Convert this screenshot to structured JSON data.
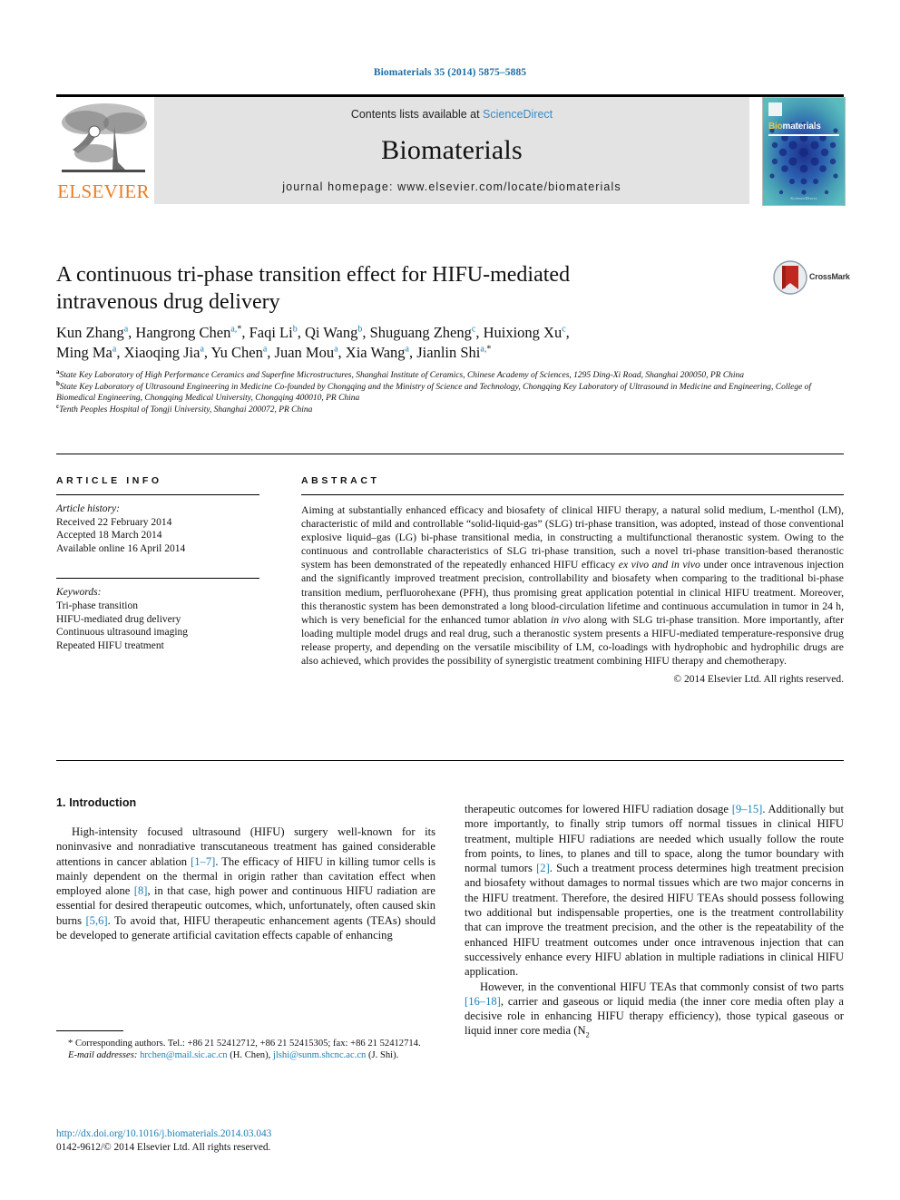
{
  "running_head": "Biomaterials 35 (2014) 5875–5885",
  "header": {
    "contents_prefix": "Contents lists available at ",
    "sciencedirect": "ScienceDirect",
    "journal_name": "Biomaterials",
    "homepage": "journal homepage: www.elsevier.com/locate/biomaterials",
    "publisher": "ELSEVIER",
    "cover_bio": "Bio",
    "cover_materials": "materials",
    "cover_footer": "Available online at\nScienceDirect",
    "accent_blue": "#3a8ac4",
    "elsevier_orange": "#ec7c22"
  },
  "article": {
    "title": "A continuous tri-phase transition effect for HIFU-mediated intravenous drug delivery",
    "crossmark_label": "CrossMark",
    "authors_line1": "Kun Zhang a, Hangrong Chen a,*, Faqi Li b, Qi Wang b, Shuguang Zheng c, Huixiong Xu c,",
    "authors_line2": "Ming Ma a, Xiaoqing Jia a, Yu Chen a, Juan Mou a, Xia Wang a, Jianlin Shi a,*",
    "affiliations": [
      {
        "marker": "a",
        "text": "State Key Laboratory of High Performance Ceramics and Superfine Microstructures, Shanghai Institute of Ceramics, Chinese Academy of Sciences, 1295 Ding-Xi Road, Shanghai 200050, PR China"
      },
      {
        "marker": "b",
        "text": "State Key Laboratory of Ultrasound Engineering in Medicine Co-founded by Chongqing and the Ministry of Science and Technology, Chongqing Key Laboratory of Ultrasound in Medicine and Engineering, College of Biomedical Engineering, Chongqing Medical University, Chongqing 400010, PR China"
      },
      {
        "marker": "c",
        "text": "Tenth Peoples Hospital of Tongji University, Shanghai 200072, PR China"
      }
    ]
  },
  "article_info": {
    "heading": "ARTICLE INFO",
    "history_label": "Article history:",
    "history": [
      "Received 22 February 2014",
      "Accepted 18 March 2014",
      "Available online 16 April 2014"
    ],
    "keywords_label": "Keywords:",
    "keywords": [
      "Tri-phase transition",
      "HIFU-mediated drug delivery",
      "Continuous ultrasound imaging",
      "Repeated HIFU treatment"
    ]
  },
  "abstract": {
    "heading": "ABSTRACT",
    "text_part1": "Aiming at substantially enhanced efficacy and biosafety of clinical HIFU therapy, a natural solid medium, L-menthol (LM), characteristic of mild and controllable “solid-liquid-gas” (SLG) tri-phase transition, was adopted, instead of those conventional explosive liquid–gas (LG) bi-phase transitional media, in constructing a multifunctional theranostic system. Owing to the continuous and controllable characteristics of SLG tri-phase transition, such a novel tri-phase transition-based theranostic system has been demonstrated of the repeatedly enhanced HIFU efficacy ",
    "em1": "ex vivo and in vivo",
    "text_part2": " under once intravenous injection and the significantly improved treatment precision, controllability and biosafety when comparing to the traditional bi-phase transition medium, perfluorohexane (PFH), thus promising great application potential in clinical HIFU treatment. Moreover, this theranostic system has been demonstrated a long blood-circulation lifetime and continuous accumulation in tumor in 24 h, which is very beneficial for the enhanced tumor ablation ",
    "em2": "in vivo",
    "text_part3": " along with SLG tri-phase transition. More importantly, after loading multiple model drugs and real drug, such a theranostic system presents a HIFU-mediated temperature-responsive drug release property, and depending on the versatile miscibility of LM, co-loadings with hydrophobic and hydrophilic drugs are also achieved, which provides the possibility of synergistic treatment combining HIFU therapy and chemotherapy.",
    "copyright": "© 2014 Elsevier Ltd. All rights reserved."
  },
  "body": {
    "section1_title": "1. Introduction",
    "left_p1_a": "High-intensity focused ultrasound (HIFU) surgery well-known for its noninvasive and nonradiative transcutaneous treatment has gained considerable attentions in cancer ablation ",
    "left_p1_ref1": "[1–7]",
    "left_p1_b": ". The efficacy of HIFU in killing tumor cells is mainly dependent on the thermal in origin rather than cavitation effect when employed alone ",
    "left_p1_ref2": "[8]",
    "left_p1_c": ", in that case, high power and continuous HIFU radiation are essential for desired therapeutic outcomes, which, unfortunately, often caused skin burns ",
    "left_p1_ref3": "[5,6]",
    "left_p1_d": ". To avoid that, HIFU therapeutic enhancement agents (TEAs) should be developed to generate artificial cavitation effects capable of enhancing",
    "right_p1_a": "therapeutic outcomes for lowered HIFU radiation dosage ",
    "right_p1_ref1": "[9–15]",
    "right_p1_b": ". Additionally but more importantly, to finally strip tumors off normal tissues in clinical HIFU treatment, multiple HIFU radiations are needed which usually follow the route from points, to lines, to planes and till to space, along the tumor boundary with normal tumors ",
    "right_p1_ref2": "[2]",
    "right_p1_c": ". Such a treatment process determines high treatment precision and biosafety without damages to normal tissues which are two major concerns in the HIFU treatment. Therefore, the desired HIFU TEAs should possess following two additional but indispensable properties, one is the treatment controllability that can improve the treatment precision, and the other is the repeatability of the enhanced HIFU treatment outcomes under once intravenous injection that can successively enhance every HIFU ablation in multiple radiations in clinical HIFU application.",
    "right_p2_a": "However, in the conventional HIFU TEAs that commonly consist of two parts ",
    "right_p2_ref1": "[16–18]",
    "right_p2_b": ", carrier and gaseous or liquid media (the inner core media often play a decisive role in enhancing HIFU therapy efficiency), those typical gaseous or liquid inner core media (N",
    "right_p2_sub": "2",
    "reference_color": "#1a7fb5"
  },
  "footnotes": {
    "corresponding": "* Corresponding authors. Tel.: +86 21 52412712, +86 21 52415305; fax: +86 21 52412714.",
    "email_label": "E-mail addresses:",
    "email1": "hrchen@mail.sic.ac.cn",
    "email1_owner": "(H. Chen),",
    "email2": "jlshi@sunm.shcnc.ac.cn",
    "email2_owner": "(J. Shi).",
    "doi": "http://dx.doi.org/10.1016/j.biomaterials.2014.03.043",
    "issn_line": "0142-9612/© 2014 Elsevier Ltd. All rights reserved."
  }
}
